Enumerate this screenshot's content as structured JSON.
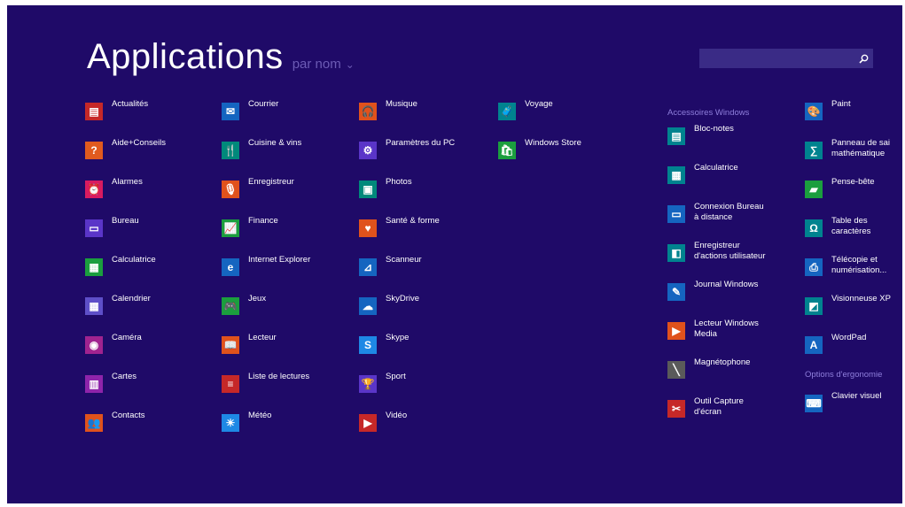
{
  "header": {
    "title": "Applications",
    "sort_label": "par nom",
    "sort_chevron": "⌄"
  },
  "search": {
    "placeholder": "",
    "icon": "search-icon"
  },
  "columns": [
    [
      {
        "label": "Actualités",
        "icon": "news-icon",
        "color": "#c62828",
        "glyph": "▤"
      },
      {
        "label": "Aide+Conseils",
        "icon": "help-icon",
        "color": "#e05a1e",
        "glyph": "?"
      },
      {
        "label": "Alarmes",
        "icon": "alarm-icon",
        "color": "#d81b60",
        "glyph": "⏰"
      },
      {
        "label": "Bureau",
        "icon": "desktop-icon",
        "color": "#5a35c8",
        "glyph": "▭"
      },
      {
        "label": "Calculatrice",
        "icon": "calculator-icon",
        "color": "#1b9e3e",
        "glyph": "▦"
      },
      {
        "label": "Calendrier",
        "icon": "calendar-icon",
        "color": "#5e4fc8",
        "glyph": "▦"
      },
      {
        "label": "Caméra",
        "icon": "camera-icon",
        "color": "#a0238f",
        "glyph": "◉"
      },
      {
        "label": "Cartes",
        "icon": "maps-icon",
        "color": "#8e24aa",
        "glyph": "▥"
      },
      {
        "label": "Contacts",
        "icon": "people-icon",
        "color": "#e0521c",
        "glyph": "👥"
      }
    ],
    [
      {
        "label": "Courrier",
        "icon": "mail-icon",
        "color": "#1565c0",
        "glyph": "✉"
      },
      {
        "label": "Cuisine & vins",
        "icon": "food-icon",
        "color": "#00897b",
        "glyph": "🍴"
      },
      {
        "label": "Enregistreur",
        "icon": "microphone-icon",
        "color": "#e0521c",
        "glyph": "🎙"
      },
      {
        "label": "Finance",
        "icon": "finance-icon",
        "color": "#1b9e3e",
        "glyph": "📈"
      },
      {
        "label": "Internet Explorer",
        "icon": "ie-icon",
        "color": "#1565c0",
        "glyph": "e"
      },
      {
        "label": "Jeux",
        "icon": "gamepad-icon",
        "color": "#1b9e3e",
        "glyph": "🎮"
      },
      {
        "label": "Lecteur",
        "icon": "reader-icon",
        "color": "#e0521c",
        "glyph": "📖"
      },
      {
        "label": "Liste de lectures",
        "icon": "reading-list-icon",
        "color": "#c62828",
        "glyph": "≡"
      },
      {
        "label": "Météo",
        "icon": "weather-icon",
        "color": "#1e88e5",
        "glyph": "☀"
      }
    ],
    [
      {
        "label": "Musique",
        "icon": "headphones-icon",
        "color": "#e0521c",
        "glyph": "🎧"
      },
      {
        "label": "Paramètres du PC",
        "icon": "settings-icon",
        "color": "#5a35c8",
        "glyph": "⚙"
      },
      {
        "label": "Photos",
        "icon": "photos-icon",
        "color": "#00897b",
        "glyph": "▣"
      },
      {
        "label": "Santé & forme",
        "icon": "health-icon",
        "color": "#e0521c",
        "glyph": "♥"
      },
      {
        "label": "Scanneur",
        "icon": "scanner-icon",
        "color": "#1565c0",
        "glyph": "⊿"
      },
      {
        "label": "SkyDrive",
        "icon": "cloud-icon",
        "color": "#1565c0",
        "glyph": "☁"
      },
      {
        "label": "Skype",
        "icon": "skype-icon",
        "color": "#1e88e5",
        "glyph": "S"
      },
      {
        "label": "Sport",
        "icon": "trophy-icon",
        "color": "#5a35c8",
        "glyph": "🏆"
      },
      {
        "label": "Vidéo",
        "icon": "video-icon",
        "color": "#c62828",
        "glyph": "▶"
      }
    ],
    [
      {
        "label": "Voyage",
        "icon": "travel-icon",
        "color": "#00838f",
        "glyph": "🧳"
      },
      {
        "label": "Windows Store",
        "icon": "store-icon",
        "color": "#1b9e3e",
        "glyph": "🛍"
      }
    ]
  ],
  "accessories": {
    "header": "Accessoires Windows",
    "items": [
      {
        "label": "Bloc-notes",
        "icon": "notepad-icon",
        "color": "#00838f",
        "glyph": "▤"
      },
      {
        "label": "Calculatrice",
        "icon": "calculator-icon",
        "color": "#00838f",
        "glyph": "▦"
      },
      {
        "label": "Connexion Bureau à distance",
        "icon": "remote-desktop-icon",
        "color": "#1565c0",
        "glyph": "▭"
      },
      {
        "label": "Enregistreur d'actions utilisateur",
        "icon": "steps-recorder-icon",
        "color": "#00838f",
        "glyph": "◧"
      },
      {
        "label": "Journal Windows",
        "icon": "journal-icon",
        "color": "#1565c0",
        "glyph": "✎"
      },
      {
        "label": "Lecteur Windows Media",
        "icon": "media-player-icon",
        "color": "#e0521c",
        "glyph": "▶"
      },
      {
        "label": "Magnétophone",
        "icon": "sound-recorder-icon",
        "color": "#5a5a5a",
        "glyph": "╲"
      },
      {
        "label": "Outil Capture d'écran",
        "icon": "snipping-tool-icon",
        "color": "#c62828",
        "glyph": "✂"
      }
    ]
  },
  "accessories_right": {
    "items": [
      {
        "label": "Paint",
        "icon": "paint-icon",
        "color": "#1565c0",
        "glyph": "🎨"
      },
      {
        "label": "Panneau de sai mathématique",
        "icon": "math-input-icon",
        "color": "#00838f",
        "glyph": "∑"
      },
      {
        "label": "Pense-bête",
        "icon": "sticky-notes-icon",
        "color": "#1b9e3e",
        "glyph": "▰"
      },
      {
        "label": "Table des caractères",
        "icon": "charmap-icon",
        "color": "#00838f",
        "glyph": "Ω"
      },
      {
        "label": "Télécopie et numérisation...",
        "icon": "fax-scan-icon",
        "color": "#1565c0",
        "glyph": "⎙"
      },
      {
        "label": "Visionneuse XP",
        "icon": "xps-viewer-icon",
        "color": "#00838f",
        "glyph": "◩"
      },
      {
        "label": "WordPad",
        "icon": "wordpad-icon",
        "color": "#1565c0",
        "glyph": "A"
      }
    ],
    "group2_header": "Options d'ergonomie",
    "group2_items": [
      {
        "label": "Clavier visuel",
        "icon": "keyboard-icon",
        "color": "#1565c0",
        "glyph": "⌨"
      }
    ]
  }
}
